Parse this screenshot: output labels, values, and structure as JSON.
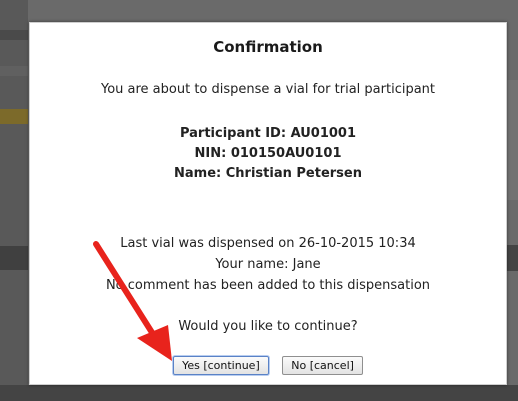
{
  "dialog": {
    "title": "Confirmation",
    "intro": "You are about to dispense a vial for trial participant",
    "participant_id": "Participant ID: AU01001",
    "nin": "NIN: 010150AU0101",
    "name": "Name: Christian Petersen",
    "last_vial": "Last vial was dispensed on 26-10-2015 10:34",
    "your_name": "Your name: Jane",
    "comment": "No comment has been added to this dispensation",
    "question": "Would you like to continue?",
    "yes_label": "Yes [continue]",
    "no_label": "No [cancel]"
  },
  "annotation": {
    "arrow_color": "#e8231c",
    "icon": "red-arrow-icon"
  }
}
